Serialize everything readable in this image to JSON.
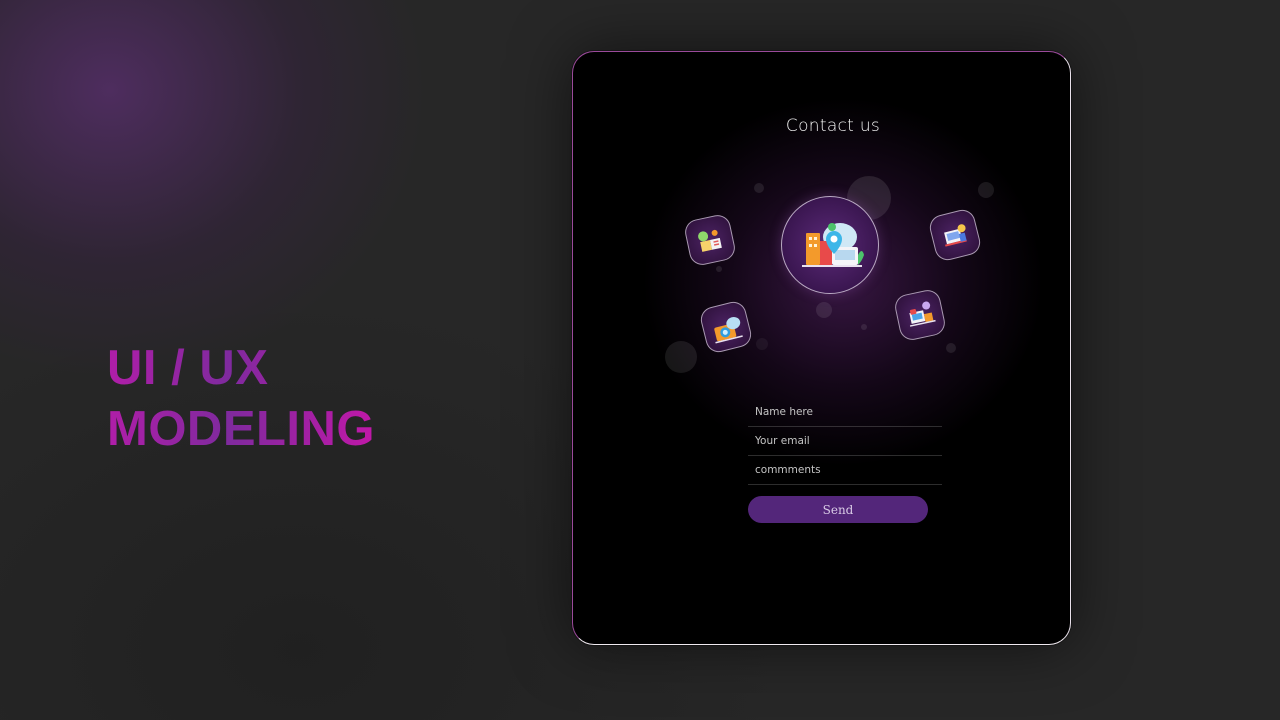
{
  "slide": {
    "headline_line1": "UI / UX",
    "headline_line2": "MODELING"
  },
  "contact_card": {
    "title": "Contact us",
    "form": {
      "name_placeholder": "Name here",
      "email_placeholder": "Your email",
      "comments_placeholder": "commments",
      "send_label": "Send"
    },
    "icons": [
      "location-pin-icon",
      "open-book-icon",
      "photo-camera-icon",
      "presentation-board-icon",
      "chat-megaphone-icon"
    ]
  },
  "colors": {
    "accent_purple": "#53267a",
    "headline_gradient_start": "#b01ea8",
    "headline_gradient_end": "#c018a8",
    "card_background": "#000000",
    "page_background": "#272727"
  }
}
